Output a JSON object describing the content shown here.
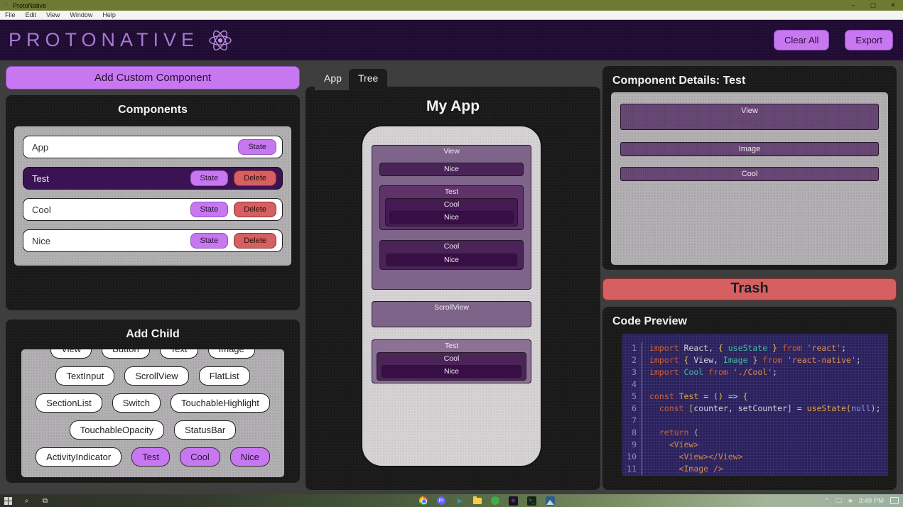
{
  "colors": {
    "accent": "#c778f0",
    "danger": "#d66061",
    "selected_row": "#3b1352"
  },
  "window": {
    "title": "ProtoNative",
    "menus": [
      "File",
      "Edit",
      "View",
      "Window",
      "Help"
    ],
    "minimize_glyph": "–",
    "maximize_glyph": "▢",
    "close_glyph": "✕"
  },
  "header": {
    "brand": "PROTONATIVE",
    "clear_all": "Clear All",
    "export": "Export"
  },
  "left": {
    "add_custom": "Add Custom Component",
    "components_title": "Components",
    "state_label": "State",
    "delete_label": "Delete",
    "components": [
      {
        "name": "App",
        "selected": false,
        "deletable": false
      },
      {
        "name": "Test",
        "selected": true,
        "deletable": true
      },
      {
        "name": "Cool",
        "selected": false,
        "deletable": true
      },
      {
        "name": "Nice",
        "selected": false,
        "deletable": true
      }
    ],
    "add_child_title": "Add Child",
    "child_rows": [
      [
        "View",
        "Button",
        "Text",
        "Image"
      ],
      [
        "TextInput",
        "ScrollView",
        "FlatList"
      ],
      [
        "SectionList",
        "Switch",
        "TouchableHighlight"
      ],
      [
        "TouchableOpacity",
        "StatusBar"
      ],
      [
        "ActivityIndicator",
        "Test",
        "Cool",
        "Nice"
      ]
    ],
    "custom_children": [
      "Test",
      "Cool",
      "Nice"
    ]
  },
  "tabs": {
    "app": "App",
    "tree": "Tree"
  },
  "canvas": {
    "title": "My App",
    "nodes": {
      "view": "View",
      "nice1": "Nice",
      "test1": "Test",
      "cool1": "Cool",
      "nice2": "Nice",
      "cool2": "Cool",
      "nice3": "Nice",
      "scrollview": "ScrollView",
      "test2": "Test",
      "cool3": "Cool",
      "nice4": "Nice"
    }
  },
  "details": {
    "title": "Component Details: Test",
    "children": [
      "View",
      "Image",
      "Cool"
    ]
  },
  "trash_label": "Trash",
  "code": {
    "title": "Code Preview",
    "token_colors": {
      "kw": "#c96235",
      "wh": "#d6d2dc",
      "br": "#dfc04c",
      "teal": "#4ab5a3",
      "name": "#dfa440",
      "str": "#de8e4e",
      "tag": "#d68a3f",
      "nul": "#8a8fe0"
    },
    "lines": [
      [
        [
          "import",
          "kw"
        ],
        [
          " React, ",
          "wh"
        ],
        [
          "{ ",
          "br"
        ],
        [
          "useState",
          "teal"
        ],
        [
          " } ",
          "br"
        ],
        [
          "from",
          "kw"
        ],
        [
          " ",
          "wh"
        ],
        [
          "'react'",
          "str"
        ],
        [
          ";",
          "wh"
        ]
      ],
      [
        [
          "import",
          "kw"
        ],
        [
          " ",
          "wh"
        ],
        [
          "{ ",
          "br"
        ],
        [
          "View, ",
          "wh"
        ],
        [
          "Image",
          "teal"
        ],
        [
          " } ",
          "br"
        ],
        [
          "from",
          "kw"
        ],
        [
          " ",
          "wh"
        ],
        [
          "'react-native'",
          "str"
        ],
        [
          ";",
          "wh"
        ]
      ],
      [
        [
          "import",
          "kw"
        ],
        [
          " ",
          "wh"
        ],
        [
          "Cool",
          "teal"
        ],
        [
          " ",
          "wh"
        ],
        [
          "from",
          "kw"
        ],
        [
          " ",
          "wh"
        ],
        [
          "'./Cool'",
          "str"
        ],
        [
          ";",
          "wh"
        ]
      ],
      [],
      [
        [
          "const",
          "kw"
        ],
        [
          " ",
          "wh"
        ],
        [
          "Test",
          "name"
        ],
        [
          " = ",
          "wh"
        ],
        [
          "()",
          "br"
        ],
        [
          " => ",
          "wh"
        ],
        [
          "{",
          "br"
        ]
      ],
      [
        [
          "  ",
          "wh"
        ],
        [
          "const",
          "kw"
        ],
        [
          " ",
          "wh"
        ],
        [
          "[",
          "br"
        ],
        [
          "counter, setCounter",
          "wh"
        ],
        [
          "]",
          "br"
        ],
        [
          " = ",
          "wh"
        ],
        [
          "useState",
          "name"
        ],
        [
          "(",
          "br"
        ],
        [
          "null",
          "nul"
        ],
        [
          ")",
          "br"
        ],
        [
          ";",
          "wh"
        ]
      ],
      [],
      [
        [
          "  ",
          "wh"
        ],
        [
          "return",
          "kw"
        ],
        [
          " ",
          "wh"
        ],
        [
          "(",
          "br"
        ]
      ],
      [
        [
          "    ",
          "wh"
        ],
        [
          "<View>",
          "tag"
        ]
      ],
      [
        [
          "      ",
          "wh"
        ],
        [
          "<View></View>",
          "tag"
        ]
      ],
      [
        [
          "      ",
          "wh"
        ],
        [
          "<Image />",
          "tag"
        ]
      ]
    ]
  },
  "taskbar": {
    "time": "3:49 PM"
  }
}
